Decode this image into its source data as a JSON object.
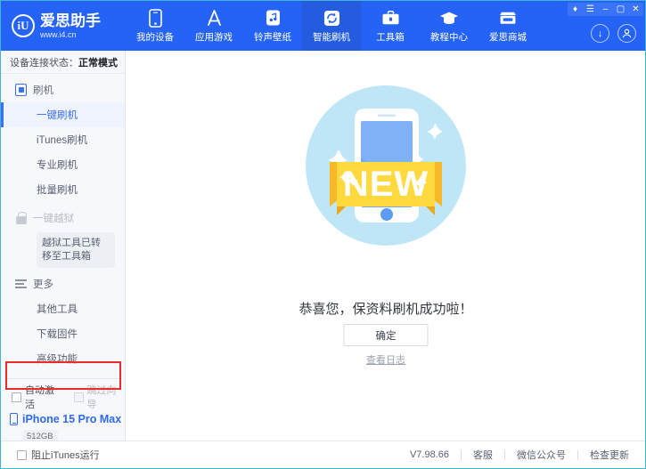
{
  "header": {
    "brand_logo_text": "iU",
    "brand_name": "爱思助手",
    "brand_url": "www.i4.cn",
    "tabs": [
      {
        "label": "我的设备",
        "icon": "phone-icon",
        "active": false
      },
      {
        "label": "应用游戏",
        "icon": "appstore-icon",
        "active": false
      },
      {
        "label": "铃声壁纸",
        "icon": "music-icon",
        "active": false
      },
      {
        "label": "智能刷机",
        "icon": "refresh-icon",
        "active": true
      },
      {
        "label": "工具箱",
        "icon": "toolbox-icon",
        "active": false
      },
      {
        "label": "教程中心",
        "icon": "graduation-cap-icon",
        "active": false
      },
      {
        "label": "爱思商城",
        "icon": "store-icon",
        "active": false
      }
    ],
    "window_buttons": [
      {
        "name": "skin-icon",
        "glyph": "♦"
      },
      {
        "name": "menu-icon",
        "glyph": "☰"
      },
      {
        "name": "minimize-icon",
        "glyph": "–"
      },
      {
        "name": "maximize-icon",
        "glyph": "▢"
      },
      {
        "name": "close-icon",
        "glyph": "✕"
      }
    ],
    "download_icon": "↓",
    "account_icon": "☺",
    "accent_color": "#2563f6",
    "active_tab_color": "#245ce0"
  },
  "sidebar": {
    "connection_label": "设备连接状态：",
    "connection_value": "正常模式",
    "groups": [
      {
        "label": "刷机",
        "icon": "flash-icon",
        "disabled": false,
        "items": [
          {
            "label": "一键刷机",
            "active": true
          },
          {
            "label": "iTunes刷机",
            "active": false
          },
          {
            "label": "专业刷机",
            "active": false
          },
          {
            "label": "批量刷机",
            "active": false
          }
        ]
      },
      {
        "label": "一键越狱",
        "icon": "lock-icon",
        "disabled": true,
        "tooltip": "越狱工具已转移至工具箱",
        "items": []
      },
      {
        "label": "更多",
        "icon": "bars-icon",
        "disabled": false,
        "items": [
          {
            "label": "其他工具",
            "active": false
          },
          {
            "label": "下载固件",
            "active": false
          },
          {
            "label": "高级功能",
            "active": false
          }
        ]
      }
    ],
    "options": [
      {
        "label": "自动激活",
        "checked": false,
        "disabled": false
      },
      {
        "label": "跳过向导",
        "checked": false,
        "disabled": true
      }
    ],
    "highlight_color": "#ee2b27",
    "device": {
      "name": "iPhone 15 Pro Max",
      "capacity": "512GB",
      "kind": "iPhone"
    }
  },
  "main": {
    "illustration": "new-phone-badge",
    "badge_text": "NEW",
    "message": "恭喜您，保资料刷机成功啦！",
    "confirm_label": "确定",
    "log_link": "查看日志"
  },
  "statusbar": {
    "block_itunes_label": "阻止iTunes运行",
    "block_itunes_checked": false,
    "version": "V7.98.66",
    "links": [
      "客服",
      "微信公众号",
      "检查更新"
    ]
  }
}
